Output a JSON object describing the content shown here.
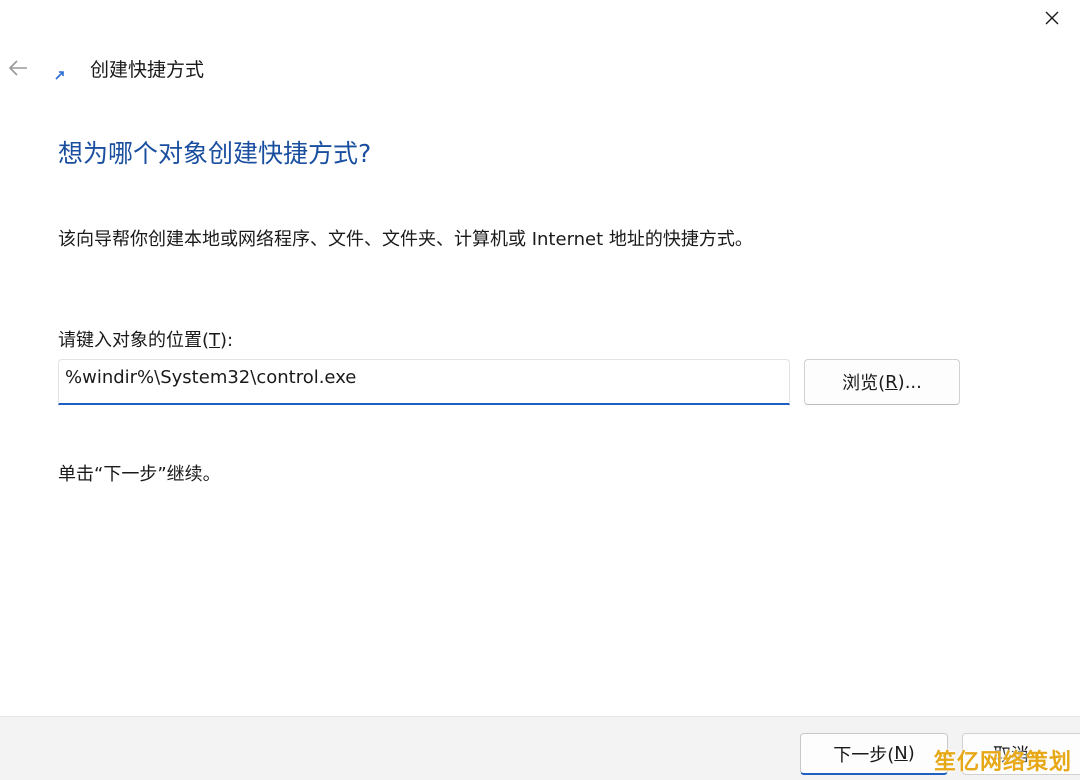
{
  "window": {
    "title": "创建快捷方式"
  },
  "page": {
    "heading": "想为哪个对象创建快捷方式?",
    "description": "该向导帮你创建本地或网络程序、文件、文件夹、计算机或 Internet 地址的快捷方式。",
    "field_label_prefix": "请键入对象的位置(",
    "field_label_key": "T",
    "field_label_suffix": "):",
    "location_value": "%windir%\\System32\\control.exe",
    "browse_prefix": "浏览(",
    "browse_key": "R",
    "browse_suffix": ")...",
    "hint": "单击“下一步”继续。"
  },
  "footer": {
    "next_prefix": "下一步(",
    "next_key": "N",
    "next_suffix": ")",
    "cancel_label": "取消"
  },
  "watermark": {
    "text": "笙亿网络策划"
  },
  "icons": {
    "close": "close-icon",
    "back": "back-arrow-icon",
    "shortcut": "shortcut-arrow-icon"
  },
  "colors": {
    "heading": "#1a4fa0",
    "accent": "#1f5fbf",
    "footer_bg": "#f3f3f3",
    "watermark": "#e6a817"
  }
}
